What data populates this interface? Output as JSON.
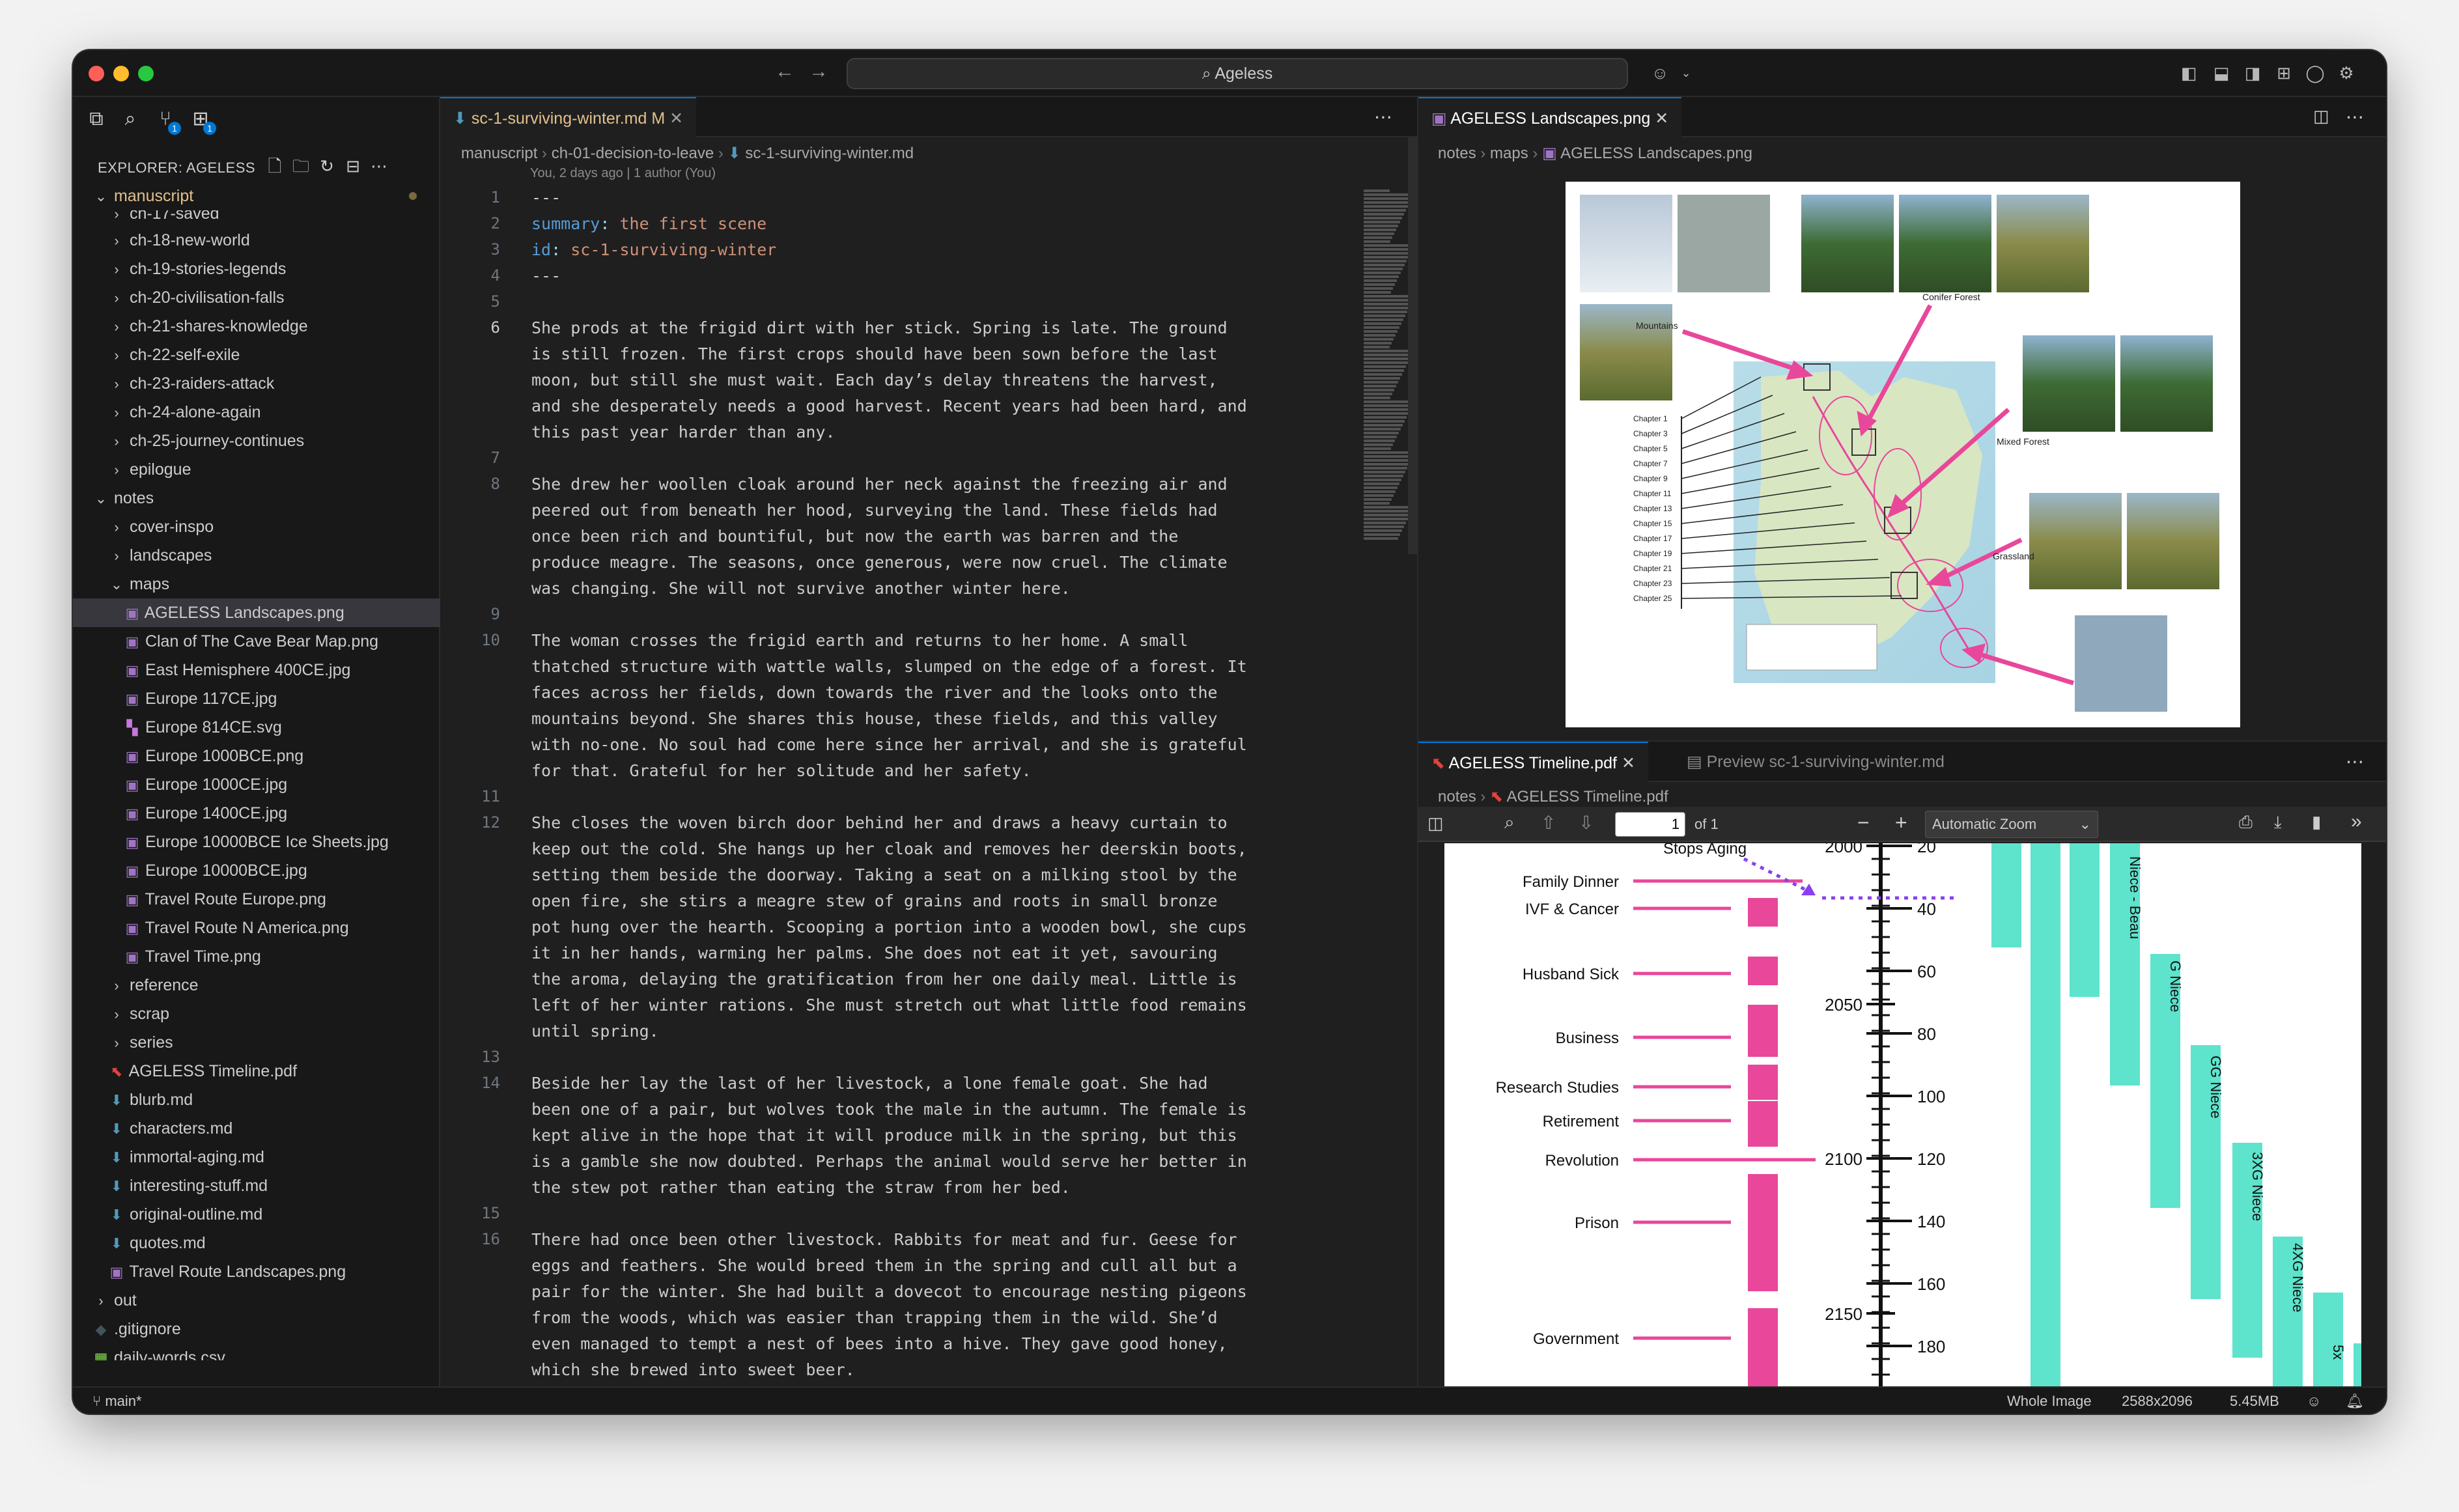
{
  "window": {
    "search_text": "Ageless",
    "search_icon": "search-icon"
  },
  "sidebar": {
    "header": "EXPLORER: AGELESS",
    "items": [
      {
        "label": "manuscript",
        "type": "folder-open",
        "indent": 0,
        "accent": true
      },
      {
        "label": "ch-17-saved",
        "type": "folder",
        "indent": 1
      },
      {
        "label": "ch-18-new-world",
        "type": "folder",
        "indent": 1
      },
      {
        "label": "ch-19-stories-legends",
        "type": "folder",
        "indent": 1
      },
      {
        "label": "ch-20-civilisation-falls",
        "type": "folder",
        "indent": 1
      },
      {
        "label": "ch-21-shares-knowledge",
        "type": "folder",
        "indent": 1
      },
      {
        "label": "ch-22-self-exile",
        "type": "folder",
        "indent": 1
      },
      {
        "label": "ch-23-raiders-attack",
        "type": "folder",
        "indent": 1
      },
      {
        "label": "ch-24-alone-again",
        "type": "folder",
        "indent": 1
      },
      {
        "label": "ch-25-journey-continues",
        "type": "folder",
        "indent": 1
      },
      {
        "label": "epilogue",
        "type": "folder",
        "indent": 1
      },
      {
        "label": "notes",
        "type": "folder-open",
        "indent": 0
      },
      {
        "label": "cover-inspo",
        "type": "folder",
        "indent": 1
      },
      {
        "label": "landscapes",
        "type": "folder",
        "indent": 1
      },
      {
        "label": "maps",
        "type": "folder-open",
        "indent": 1
      },
      {
        "label": "AGELESS Landscapes.png",
        "type": "image",
        "indent": 2,
        "selected": true
      },
      {
        "label": "Clan of The Cave Bear Map.png",
        "type": "image",
        "indent": 2
      },
      {
        "label": "East Hemisphere 400CE.jpg",
        "type": "image",
        "indent": 2
      },
      {
        "label": "Europe 117CE.jpg",
        "type": "image",
        "indent": 2
      },
      {
        "label": "Europe 814CE.svg",
        "type": "svg",
        "indent": 2
      },
      {
        "label": "Europe 1000BCE.png",
        "type": "image",
        "indent": 2
      },
      {
        "label": "Europe 1000CE.jpg",
        "type": "image",
        "indent": 2
      },
      {
        "label": "Europe 1400CE.jpg",
        "type": "image",
        "indent": 2
      },
      {
        "label": "Europe 10000BCE Ice Sheets.jpg",
        "type": "image",
        "indent": 2
      },
      {
        "label": "Europe 10000BCE.jpg",
        "type": "image",
        "indent": 2
      },
      {
        "label": "Travel Route Europe.png",
        "type": "image",
        "indent": 2
      },
      {
        "label": "Travel Route N America.png",
        "type": "image",
        "indent": 2
      },
      {
        "label": "Travel Time.png",
        "type": "image",
        "indent": 2
      },
      {
        "label": "reference",
        "type": "folder",
        "indent": 1
      },
      {
        "label": "scrap",
        "type": "folder",
        "indent": 1
      },
      {
        "label": "series",
        "type": "folder",
        "indent": 1
      },
      {
        "label": "AGELESS Timeline.pdf",
        "type": "pdf",
        "indent": 1
      },
      {
        "label": "blurb.md",
        "type": "md",
        "indent": 1
      },
      {
        "label": "characters.md",
        "type": "md",
        "indent": 1
      },
      {
        "label": "immortal-aging.md",
        "type": "md",
        "indent": 1
      },
      {
        "label": "interesting-stuff.md",
        "type": "md",
        "indent": 1
      },
      {
        "label": "original-outline.md",
        "type": "md",
        "indent": 1
      },
      {
        "label": "quotes.md",
        "type": "md",
        "indent": 1
      },
      {
        "label": "Travel Route Landscapes.png",
        "type": "image",
        "indent": 1
      },
      {
        "label": "out",
        "type": "folder",
        "indent": 0
      },
      {
        "label": ".gitignore",
        "type": "git",
        "indent": 0
      },
      {
        "label": "daily-words.csv",
        "type": "csv",
        "indent": 0
      }
    ]
  },
  "editor": {
    "tab_label": "sc-1-surviving-winter.md",
    "tab_status": "M",
    "breadcrumb": [
      "manuscript",
      "ch-01-decision-to-leave",
      "sc-1-surviving-winter.md"
    ],
    "blame": "You, 2 days ago | 1 author (You)",
    "lines": [
      {
        "n": "1",
        "segs": [
          {
            "t": "---",
            "c": ""
          }
        ]
      },
      {
        "n": "2",
        "segs": [
          {
            "t": "summary",
            "c": "k"
          },
          {
            "t": ": ",
            "c": "sep"
          },
          {
            "t": "the first scene",
            "c": "v"
          }
        ]
      },
      {
        "n": "3",
        "segs": [
          {
            "t": "id",
            "c": "k"
          },
          {
            "t": ": ",
            "c": "sep"
          },
          {
            "t": "sc-1-surviving-winter",
            "c": "v"
          }
        ]
      },
      {
        "n": "4",
        "segs": [
          {
            "t": "---",
            "c": ""
          }
        ]
      },
      {
        "n": "5",
        "segs": []
      },
      {
        "n": "6",
        "segs": [
          {
            "t": "She prods at the frigid dirt with her stick. Spring is late. The ground",
            "c": ""
          }
        ]
      },
      {
        "n": "",
        "segs": [
          {
            "t": "is still frozen. The first crops should have been sown before the last",
            "c": ""
          }
        ]
      },
      {
        "n": "",
        "segs": [
          {
            "t": "moon, but still she must wait. Each day’s delay threatens the harvest,",
            "c": ""
          }
        ]
      },
      {
        "n": "",
        "segs": [
          {
            "t": "and she desperately needs a good harvest. Recent years had been hard, and",
            "c": ""
          }
        ]
      },
      {
        "n": "",
        "segs": [
          {
            "t": "this past year harder than any.",
            "c": ""
          }
        ]
      },
      {
        "n": "7",
        "segs": []
      },
      {
        "n": "8",
        "segs": [
          {
            "t": "She drew her woollen cloak around her neck against the freezing air and",
            "c": ""
          }
        ]
      },
      {
        "n": "",
        "segs": [
          {
            "t": "peered out from beneath her hood, surveying the land. These fields had",
            "c": ""
          }
        ]
      },
      {
        "n": "",
        "segs": [
          {
            "t": "once been rich and bountiful, but now the earth was barren and the",
            "c": ""
          }
        ]
      },
      {
        "n": "",
        "segs": [
          {
            "t": "produce meagre. The seasons, once generous, were now cruel. The climate",
            "c": ""
          }
        ]
      },
      {
        "n": "",
        "segs": [
          {
            "t": "was changing. She will not survive another winter here.",
            "c": ""
          }
        ]
      },
      {
        "n": "9",
        "segs": []
      },
      {
        "n": "10",
        "segs": [
          {
            "t": "The woman crosses the frigid earth and returns to her home. A small",
            "c": ""
          }
        ]
      },
      {
        "n": "",
        "segs": [
          {
            "t": "thatched structure with wattle walls, slumped on the edge of a forest. It",
            "c": ""
          }
        ]
      },
      {
        "n": "",
        "segs": [
          {
            "t": "faces across her fields, down towards the river and the looks onto the",
            "c": ""
          }
        ]
      },
      {
        "n": "",
        "segs": [
          {
            "t": "mountains beyond. She shares this house, these fields, and this valley",
            "c": ""
          }
        ]
      },
      {
        "n": "",
        "segs": [
          {
            "t": "with no-one. No soul had come here since her arrival, and she is grateful",
            "c": ""
          }
        ]
      },
      {
        "n": "",
        "segs": [
          {
            "t": "for that. Grateful for her solitude and her safety.",
            "c": ""
          }
        ]
      },
      {
        "n": "11",
        "segs": []
      },
      {
        "n": "12",
        "segs": [
          {
            "t": "She closes the woven birch door behind her and draws a heavy curtain to",
            "c": ""
          }
        ]
      },
      {
        "n": "",
        "segs": [
          {
            "t": "keep out the cold. She hangs up her cloak and removes her deerskin boots,",
            "c": ""
          }
        ]
      },
      {
        "n": "",
        "segs": [
          {
            "t": "setting them beside the doorway. Taking a seat on a milking stool by the",
            "c": ""
          }
        ]
      },
      {
        "n": "",
        "segs": [
          {
            "t": "open fire, she stirs a meagre stew of grains and roots in small bronze",
            "c": ""
          }
        ]
      },
      {
        "n": "",
        "segs": [
          {
            "t": "pot hung over the hearth. Scooping a portion into a wooden bowl, she cups",
            "c": ""
          }
        ]
      },
      {
        "n": "",
        "segs": [
          {
            "t": "it in her hands, warming her palms. She does not eat it yet, savouring",
            "c": ""
          }
        ]
      },
      {
        "n": "",
        "segs": [
          {
            "t": "the aroma, delaying the gratification from her one daily meal. Little is",
            "c": ""
          }
        ]
      },
      {
        "n": "",
        "segs": [
          {
            "t": "left of her winter rations. She must stretch out what little food remains",
            "c": ""
          }
        ]
      },
      {
        "n": "",
        "segs": [
          {
            "t": "until spring.",
            "c": ""
          }
        ]
      },
      {
        "n": "13",
        "segs": []
      },
      {
        "n": "14",
        "segs": [
          {
            "t": "Beside her lay the last of her livestock, a lone female goat. She had",
            "c": ""
          }
        ]
      },
      {
        "n": "",
        "segs": [
          {
            "t": "been one of a pair, but wolves took the male in the autumn. The female is",
            "c": ""
          }
        ]
      },
      {
        "n": "",
        "segs": [
          {
            "t": "kept alive in the hope that it will produce milk in the spring, but this",
            "c": ""
          }
        ]
      },
      {
        "n": "",
        "segs": [
          {
            "t": "is a gamble she now doubted. Perhaps the animal would serve her better in",
            "c": ""
          }
        ]
      },
      {
        "n": "",
        "segs": [
          {
            "t": "the stew pot rather than eating the straw from her bed.",
            "c": ""
          }
        ]
      },
      {
        "n": "15",
        "segs": []
      },
      {
        "n": "16",
        "segs": [
          {
            "t": "There had once been other livestock. Rabbits for meat and fur. Geese for",
            "c": ""
          }
        ]
      },
      {
        "n": "",
        "segs": [
          {
            "t": "eggs and feathers. She would breed them in the spring and cull all but a",
            "c": ""
          }
        ]
      },
      {
        "n": "",
        "segs": [
          {
            "t": "pair for the winter. She had built a dovecot to encourage nesting pigeons",
            "c": ""
          }
        ]
      },
      {
        "n": "",
        "segs": [
          {
            "t": "from the woods, which was easier than trapping them in the wild. She’d",
            "c": ""
          }
        ]
      },
      {
        "n": "",
        "segs": [
          {
            "t": "even managed to tempt a nest of bees into a hive. They gave good honey,",
            "c": ""
          }
        ]
      },
      {
        "n": "",
        "segs": [
          {
            "t": "which she brewed into sweet beer.",
            "c": ""
          }
        ]
      }
    ]
  },
  "image_view": {
    "tab_label": "AGELESS Landscapes.png",
    "breadcrumb": [
      "notes",
      "maps",
      "AGELESS Landscapes.png"
    ],
    "labels": {
      "mountains": "Mountains",
      "conifer": "Conifer Forest",
      "mixed": "Mixed Forest",
      "grassland": "Grassland"
    },
    "chapters": [
      "Chapter 1",
      "Chapter 3",
      "Chapter 5",
      "Chapter 7",
      "Chapter 9",
      "Chapter 11",
      "Chapter 13",
      "Chapter 15",
      "Chapter 17",
      "Chapter 19",
      "Chapter 21",
      "Chapter 23",
      "Chapter 25"
    ]
  },
  "pdf_view": {
    "tab_label": "AGELESS Timeline.pdf",
    "tab2_label": "Preview sc-1-surviving-winter.md",
    "breadcrumb": [
      "notes",
      "AGELESS Timeline.pdf"
    ],
    "page_value": "1",
    "page_of": "of 1",
    "zoom": "Automatic Zoom",
    "events": [
      "Family Dinner",
      "IVF & Cancer",
      "Husband Sick",
      "Business",
      "Research Studies",
      "Retirement",
      "Revolution",
      "Prison",
      "Government"
    ],
    "stops_aging": "Stops Aging",
    "years": [
      "2000",
      "2050",
      "2100",
      "2150"
    ],
    "ages": [
      "20",
      "40",
      "60",
      "80",
      "100",
      "120",
      "140",
      "160",
      "180"
    ],
    "relatives": [
      "Niece - Beau",
      "G Niece",
      "GG Niece",
      "3XG Niece",
      "4XG Niece",
      "5x"
    ]
  },
  "statusbar": {
    "branch": "main*",
    "image_kind": "Whole Image",
    "image_dims": "2588x2096",
    "image_size": "5.45MB"
  },
  "colors": {
    "accent": "#0078d4",
    "pink": "#e8479a",
    "teal": "#5ee3cc",
    "purple": "#8a3ff0"
  }
}
